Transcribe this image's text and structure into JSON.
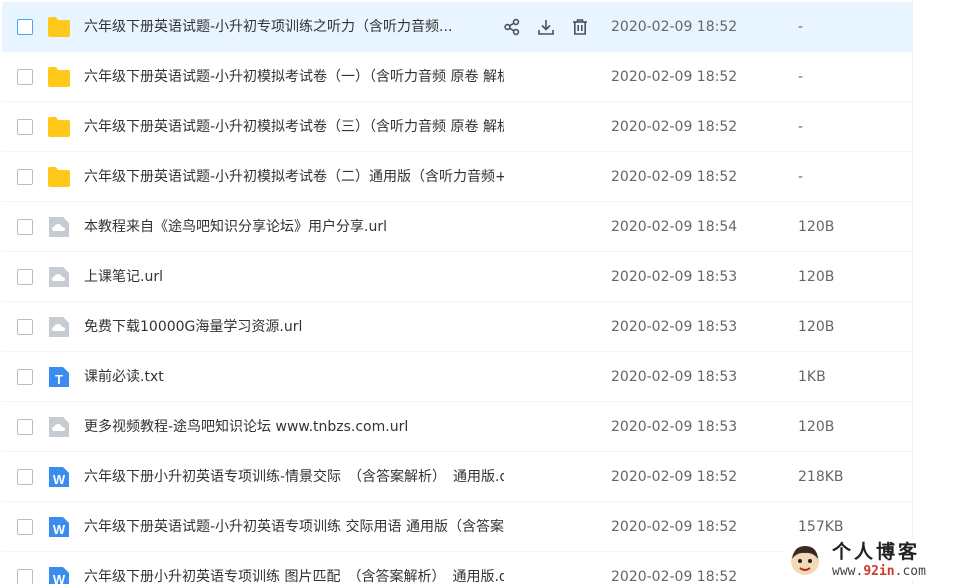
{
  "files": [
    {
      "name": "六年级下册英语试题-小升初专项训练之听力（含听力音频...",
      "date": "2020-02-09 18:52",
      "size": "-",
      "type": "folder",
      "selected": true
    },
    {
      "name": "六年级下册英语试题-小升初模拟考试卷（一）（含听力音频 原卷 解析卷...",
      "date": "2020-02-09 18:52",
      "size": "-",
      "type": "folder"
    },
    {
      "name": "六年级下册英语试题-小升初模拟考试卷（三）（含听力音频 原卷 解析卷...",
      "date": "2020-02-09 18:52",
      "size": "-",
      "type": "folder"
    },
    {
      "name": "六年级下册英语试题-小升初模拟考试卷（二）通用版（含听力音频+原卷...",
      "date": "2020-02-09 18:52",
      "size": "-",
      "type": "folder"
    },
    {
      "name": "本教程来自《途鸟吧知识分享论坛》用户分享.url",
      "date": "2020-02-09 18:54",
      "size": "120B",
      "type": "url"
    },
    {
      "name": "上课笔记.url",
      "date": "2020-02-09 18:53",
      "size": "120B",
      "type": "url"
    },
    {
      "name": "免费下载10000G海量学习资源.url",
      "date": "2020-02-09 18:53",
      "size": "120B",
      "type": "url"
    },
    {
      "name": "课前必读.txt",
      "date": "2020-02-09 18:53",
      "size": "1KB",
      "type": "txt"
    },
    {
      "name": "更多视频教程-途鸟吧知识论坛 www.tnbzs.com.url",
      "date": "2020-02-09 18:53",
      "size": "120B",
      "type": "url"
    },
    {
      "name": "六年级下册小升初英语专项训练-情景交际　（含答案解析）　通用版.docx",
      "date": "2020-02-09 18:52",
      "size": "218KB",
      "type": "docx"
    },
    {
      "name": "六年级下册英语试题-小升初英语专项训练 交际用语 通用版（含答案解析...",
      "date": "2020-02-09 18:52",
      "size": "157KB",
      "type": "docx"
    },
    {
      "name": "六年级下册小升初英语专项训练 图片匹配　（含答案解析）　通用版.docx",
      "date": "2020-02-09 18:52",
      "size": "",
      "type": "docx"
    }
  ],
  "icon_letters": {
    "txt": "T",
    "docx": "W"
  },
  "colors": {
    "folder": "#ffc81a",
    "url_icon": "#c7ccd3",
    "txt_icon": "#3b8cf0",
    "docx_icon": "#3b8cf0",
    "selected_bg": "#e8f4ff",
    "action_icon": "#4a5060"
  },
  "watermark": {
    "title": "个人博客",
    "url_prefix": "www.",
    "url_brand": "92in",
    "url_suffix": ".com"
  }
}
